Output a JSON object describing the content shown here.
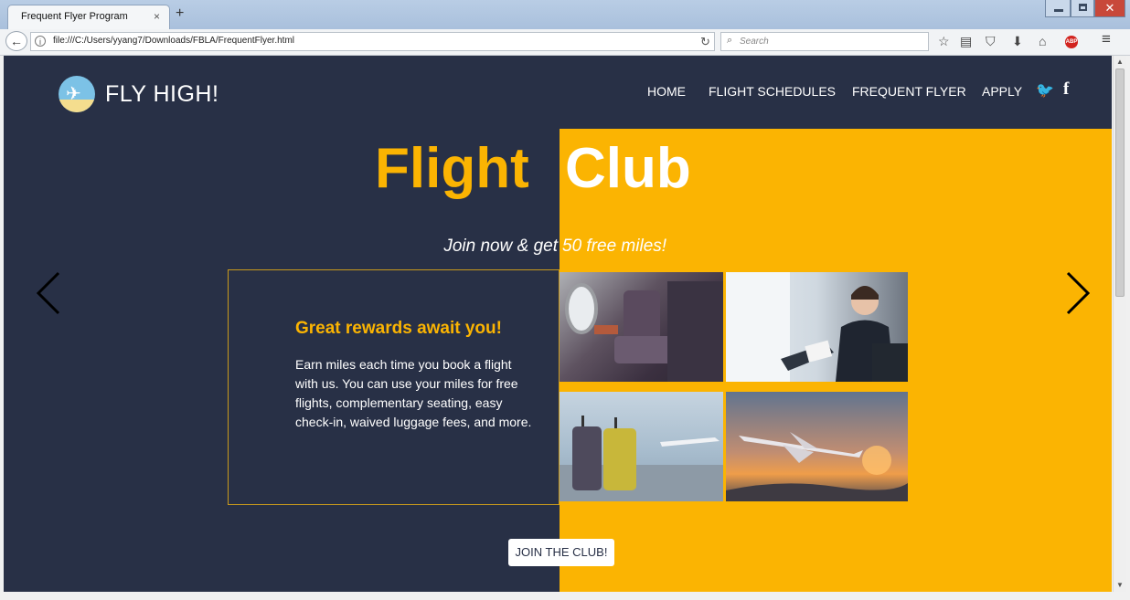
{
  "browser": {
    "tab_title": "Frequent Flyer Program",
    "tab_close": "×",
    "new_tab": "+",
    "close_glyph": "✕",
    "back_glyph": "←",
    "info_glyph": "i",
    "url": "file:///C:/Users/yyang7/Downloads/FBLA/FrequentFlyer.html",
    "reload_glyph": "↻",
    "search_glyph": "⌕",
    "search_placeholder": "Search",
    "toolbar_icons": [
      "bookmark-star-icon",
      "reading-list-icon",
      "pocket-icon",
      "download-icon",
      "home-icon",
      "adblock-icon",
      "menu-icon"
    ],
    "toolbar_glyphs": {
      "star": "☆",
      "list": "▤",
      "pocket": "⛉",
      "download": "⬇",
      "home": "⌂",
      "menu": "≡",
      "abp": "ABP"
    }
  },
  "site": {
    "brand": "FLY HIGH!",
    "logo_glyph": "✈",
    "nav": [
      {
        "label": "HOME"
      },
      {
        "label": "FLIGHT SCHEDULES"
      },
      {
        "label": "FREQUENT FLYER"
      },
      {
        "label": "APPLY"
      }
    ],
    "social": {
      "twitter": "🐦",
      "facebook": "f"
    }
  },
  "hero": {
    "title_part1": "Flight",
    "title_part2": "Club",
    "subtitle_part1": "Join now & get",
    "subtitle_part2": "50 free miles!"
  },
  "info": {
    "title": "Great rewards await you!",
    "text": "Earn miles each time you book a flight with us. You can use your miles for free flights, complementary seating, easy check-in, waived luggage fees, and more."
  },
  "cta": {
    "label": "JOIN THE CLUB!"
  },
  "colors": {
    "navy": "#283046",
    "yellow": "#fbb402",
    "white": "#ffffff"
  }
}
